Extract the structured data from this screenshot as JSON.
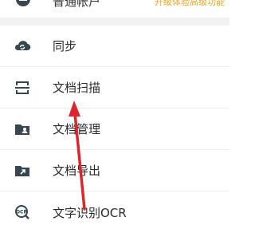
{
  "header": {
    "account_label": "普通帐户",
    "upgrade_label": "升级体验高级功能"
  },
  "menu": {
    "items": [
      {
        "label": "同步",
        "icon": "cloud-sync-icon"
      },
      {
        "label": "文档扫描",
        "icon": "scan-frame-icon"
      },
      {
        "label": "文档管理",
        "icon": "folder-person-icon"
      },
      {
        "label": "文档导出",
        "icon": "folder-export-icon"
      },
      {
        "label": "文字识别OCR",
        "icon": "ocr-icon"
      }
    ]
  },
  "colors": {
    "icon": "#37474f",
    "text": "#2b2b2b",
    "upgrade": "#f5a623",
    "annotation_arrow": "#e0242b"
  }
}
